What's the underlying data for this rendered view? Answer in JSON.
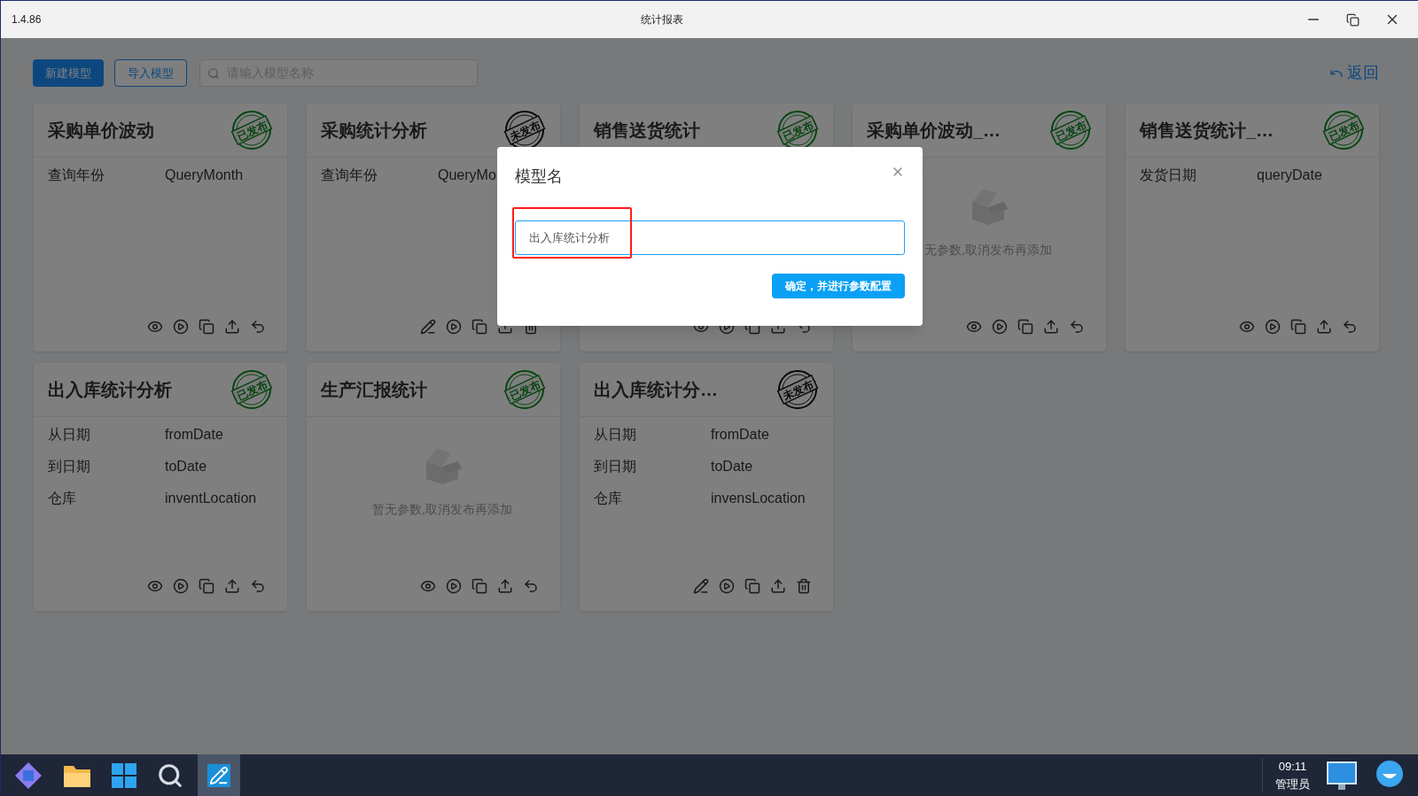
{
  "window": {
    "version": "1.4.86",
    "title": "统计报表"
  },
  "toolbar": {
    "new_button": "新建模型",
    "import_button": "导入模型",
    "search": {
      "placeholder": "请输入模型名称"
    },
    "back_link": "返回"
  },
  "cards": [
    {
      "title": "采购单价波动",
      "published": true,
      "stamp": "已发布",
      "params": [
        {
          "label": "查询年份",
          "value": "QueryMonth"
        }
      ]
    },
    {
      "title": "采购统计分析",
      "published": false,
      "stamp": "未发布",
      "params": [
        {
          "label": "查询年份",
          "value": "QueryMo"
        }
      ]
    },
    {
      "title": "销售送货统计",
      "published": true,
      "stamp": "已发布"
    },
    {
      "title": "采购单价波动_…",
      "published": true,
      "stamp": "已发布",
      "empty_text": "无参数,取消发布再添加"
    },
    {
      "title": "销售送货统计_…",
      "published": true,
      "stamp": "已发布",
      "params": [
        {
          "label": "发货日期",
          "value": "queryDate"
        }
      ]
    },
    {
      "title": "出入库统计分析",
      "published": true,
      "stamp": "已发布",
      "params": [
        {
          "label": "从日期",
          "value": "fromDate"
        },
        {
          "label": "到日期",
          "value": "toDate"
        },
        {
          "label": "仓库",
          "value": "inventLocation"
        }
      ]
    },
    {
      "title": "生产汇报统计",
      "published": true,
      "stamp": "已发布",
      "empty_text": "暂无参数,取消发布再添加"
    },
    {
      "title": "出入库统计分…",
      "published": false,
      "stamp": "未发布",
      "params": [
        {
          "label": "从日期",
          "value": "fromDate"
        },
        {
          "label": "到日期",
          "value": "toDate"
        },
        {
          "label": "仓库",
          "value": "invensLocation"
        }
      ]
    }
  ],
  "dialog": {
    "title": "模型名",
    "input_value": "出入库统计分析",
    "confirm_button": "确定，并进行参数配置"
  },
  "taskbar": {
    "time": "09:11",
    "user": "管理员"
  }
}
